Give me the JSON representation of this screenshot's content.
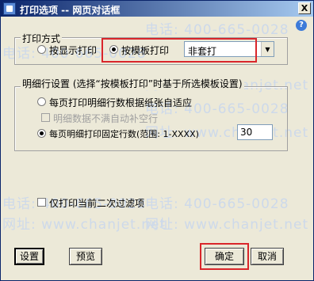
{
  "window": {
    "title": "打印选项 -- 网页对话框",
    "close_glyph": "X",
    "help_glyph": "?"
  },
  "watermark": {
    "phone": "电话: 400-665-0028",
    "site": "网址: www.chanjet.net"
  },
  "print_mode": {
    "legend": "打印方式",
    "option_display": "按显示打印",
    "option_template": "按模板打印",
    "template_value": "非套打"
  },
  "detail_rows": {
    "legend": "明细行设置 (选择“按模板打印”时基于所选模板设置)",
    "option_auto": "每页打印明细行数根据纸张自适应",
    "fill_empty_label": "明细数据不满自动补空行",
    "option_fixed": "每页明细打印固定行数(范围: 1-XXXX)",
    "fixed_rows_value": "30"
  },
  "filter": {
    "label": "仅打印当前二次过滤项"
  },
  "buttons": {
    "setup": "设置",
    "preview": "预览",
    "ok": "确定",
    "cancel": "取消"
  },
  "colors": {
    "highlight": "#d9262b",
    "titlebar_start": "#0a246a",
    "titlebar_end": "#a6caf0",
    "dialog_bg": "#ece9d8"
  }
}
